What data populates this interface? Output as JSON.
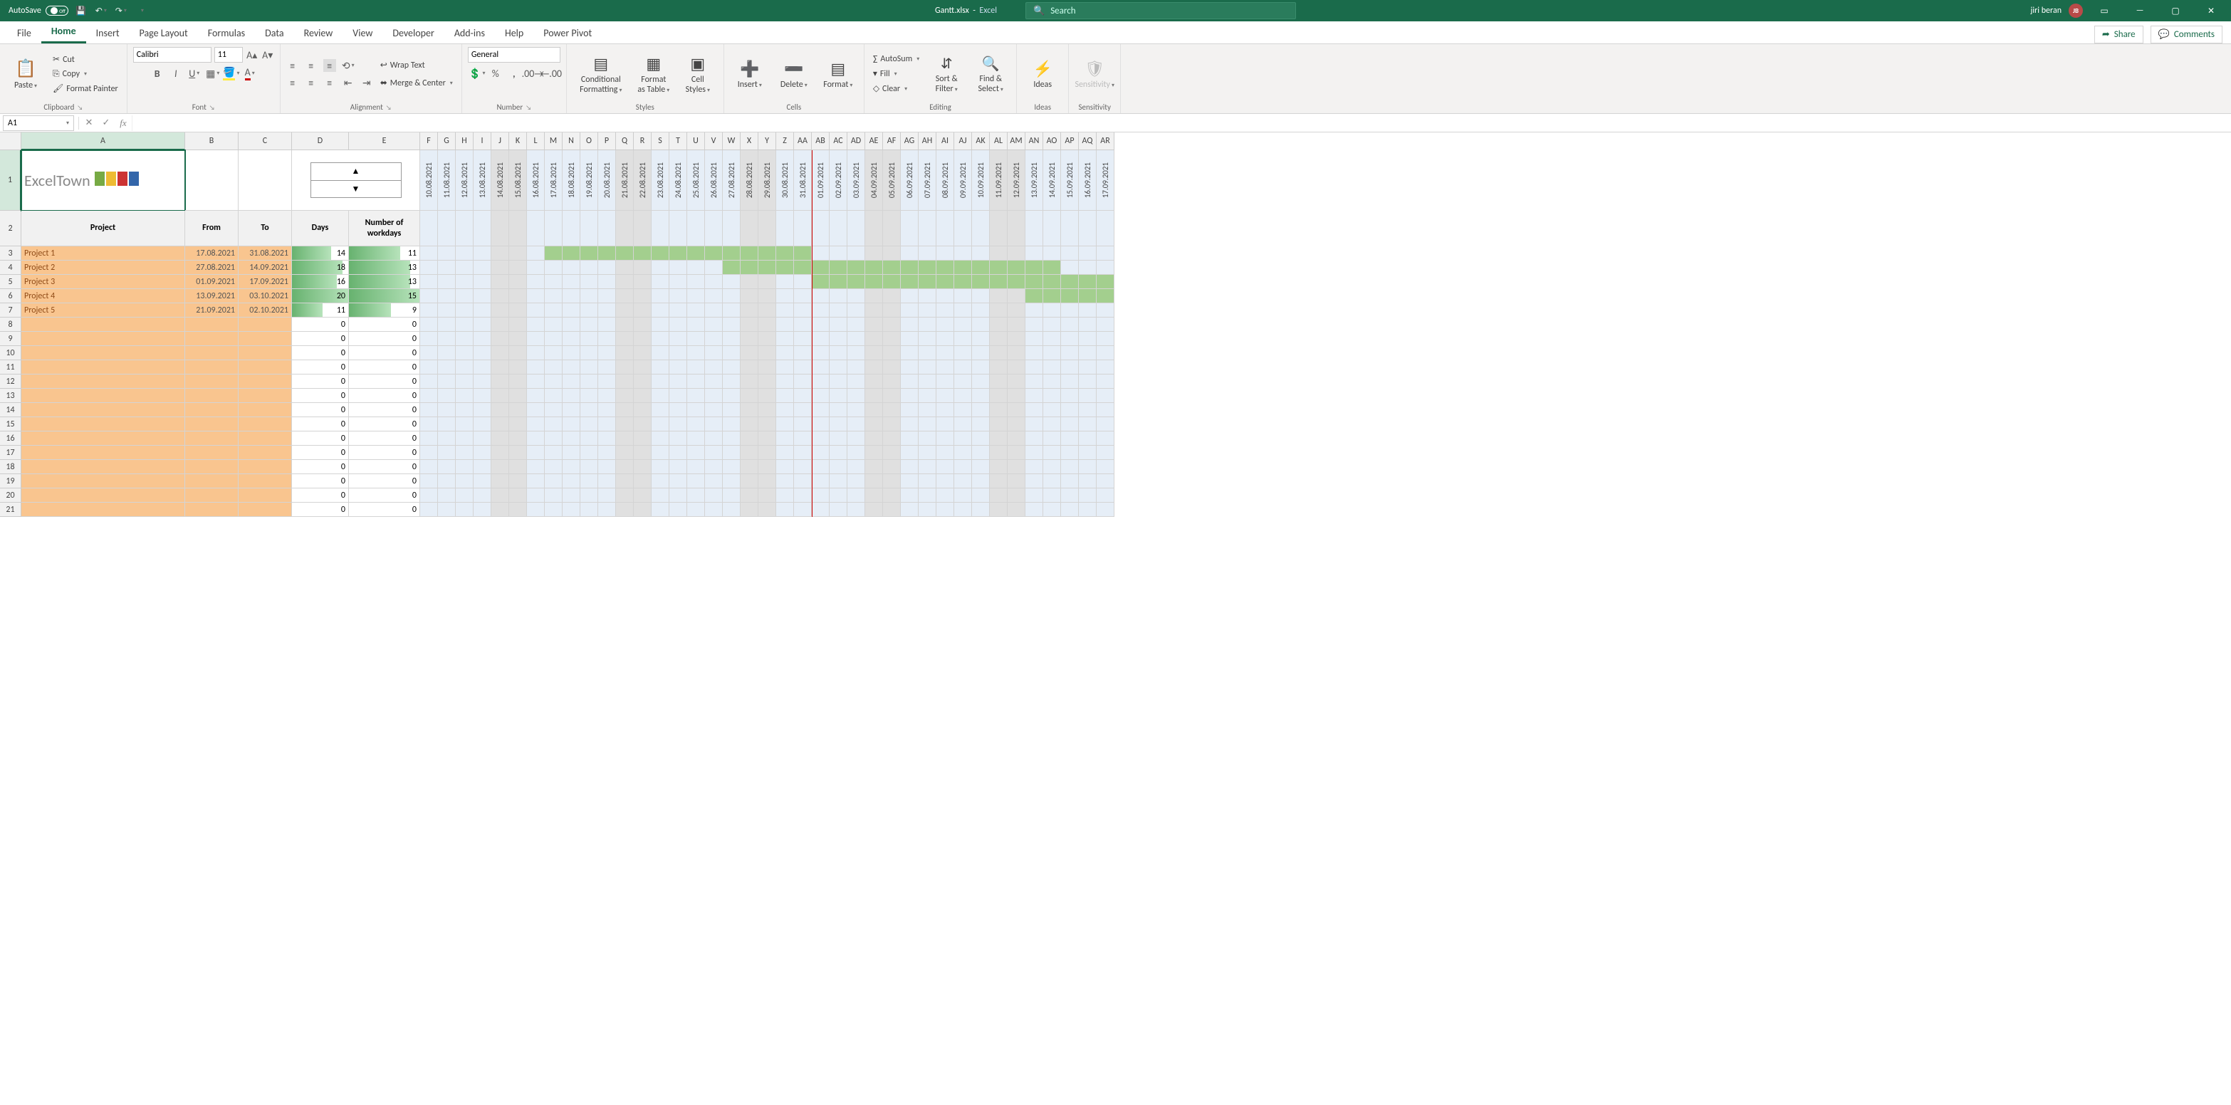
{
  "titlebar": {
    "autosave_label": "AutoSave",
    "autosave_state": "Off",
    "doc_title": "Gantt.xlsx",
    "app_name": "Excel",
    "search_placeholder": "Search",
    "user_name": "jiri beran",
    "user_initials": "JB"
  },
  "tabs": {
    "file": "File",
    "home": "Home",
    "insert": "Insert",
    "page_layout": "Page Layout",
    "formulas": "Formulas",
    "data": "Data",
    "review": "Review",
    "view": "View",
    "developer": "Developer",
    "addins": "Add-ins",
    "help": "Help",
    "power_pivot": "Power Pivot",
    "share": "Share",
    "comments": "Comments"
  },
  "ribbon": {
    "clipboard": {
      "label": "Clipboard",
      "paste": "Paste",
      "cut": "Cut",
      "copy": "Copy",
      "format_painter": "Format Painter"
    },
    "font": {
      "label": "Font",
      "name": "Calibri",
      "size": "11"
    },
    "alignment": {
      "label": "Alignment",
      "wrap": "Wrap Text",
      "merge": "Merge & Center"
    },
    "number": {
      "label": "Number",
      "format": "General"
    },
    "styles": {
      "label": "Styles",
      "cond": "Conditional Formatting",
      "table": "Format as Table",
      "cellstyles": "Cell Styles"
    },
    "cells": {
      "label": "Cells",
      "insert": "Insert",
      "delete": "Delete",
      "format": "Format"
    },
    "editing": {
      "label": "Editing",
      "autosum": "AutoSum",
      "fill": "Fill",
      "clear": "Clear",
      "sort": "Sort & Filter",
      "find": "Find & Select"
    },
    "ideas": {
      "label": "Ideas",
      "btn": "Ideas"
    },
    "sensitivity": {
      "label": "Sensitivity",
      "btn": "Sensitivity"
    }
  },
  "fbar": {
    "namebox": "A1"
  },
  "logo": "ExcelTown",
  "sheet": {
    "headers": {
      "project": "Project",
      "from": "From",
      "to": "To",
      "days": "Days",
      "workdays": "Number of workdays"
    },
    "col_letters": [
      "F",
      "G",
      "H",
      "I",
      "J",
      "K",
      "L",
      "M",
      "N",
      "O",
      "P",
      "Q",
      "R",
      "S",
      "T",
      "U",
      "V",
      "W",
      "X",
      "Y",
      "Z",
      "AA",
      "AB",
      "AC",
      "AD",
      "AE",
      "AF",
      "AG",
      "AH",
      "AI",
      "AJ",
      "AK",
      "AL",
      "AM",
      "AN",
      "AO",
      "AP",
      "AQ",
      "AR"
    ],
    "dates": [
      "10.08.2021",
      "11.08.2021",
      "12.08.2021",
      "13.08.2021",
      "14.08.2021",
      "15.08.2021",
      "16.08.2021",
      "17.08.2021",
      "18.08.2021",
      "19.08.2021",
      "20.08.2021",
      "21.08.2021",
      "22.08.2021",
      "23.08.2021",
      "24.08.2021",
      "25.08.2021",
      "26.08.2021",
      "27.08.2021",
      "28.08.2021",
      "29.08.2021",
      "30.08.2021",
      "31.08.2021",
      "01.09.2021",
      "02.09.2021",
      "03.09.2021",
      "04.09.2021",
      "05.09.2021",
      "06.09.2021",
      "07.09.2021",
      "08.09.2021",
      "09.09.2021",
      "10.09.2021",
      "11.09.2021",
      "12.09.2021",
      "13.09.2021",
      "14.09.2021",
      "15.09.2021",
      "16.09.2021",
      "17.09.2021"
    ],
    "weekend_idx": [
      4,
      5,
      11,
      12,
      18,
      19,
      25,
      26,
      32,
      33
    ],
    "today_idx": 22,
    "projects": [
      {
        "name": "Project 1",
        "from": "17.08.2021",
        "to": "31.08.2021",
        "days": 14,
        "workdays": 11,
        "gantt_start": 7,
        "gantt_end": 21
      },
      {
        "name": "Project 2",
        "from": "27.08.2021",
        "to": "14.09.2021",
        "days": 18,
        "workdays": 13,
        "gantt_start": 17,
        "gantt_end": 35
      },
      {
        "name": "Project 3",
        "from": "01.09.2021",
        "to": "17.09.2021",
        "days": 16,
        "workdays": 13,
        "gantt_start": 22,
        "gantt_end": 38
      },
      {
        "name": "Project 4",
        "from": "13.09.2021",
        "to": "03.10.2021",
        "days": 20,
        "workdays": 15,
        "gantt_start": 34,
        "gantt_end": 38
      },
      {
        "name": "Project 5",
        "from": "21.09.2021",
        "to": "02.10.2021",
        "days": 11,
        "workdays": 9,
        "gantt_start": 99,
        "gantt_end": 99
      }
    ],
    "max_days": 20,
    "max_workdays": 15,
    "empty_rows": 14,
    "zero": "0"
  },
  "col_widths": {
    "A": 230,
    "B": 75,
    "C": 75,
    "D": 80,
    "E": 100,
    "date": 25
  },
  "row_heights": {
    "r1": 85,
    "r2": 50,
    "data": 20
  }
}
